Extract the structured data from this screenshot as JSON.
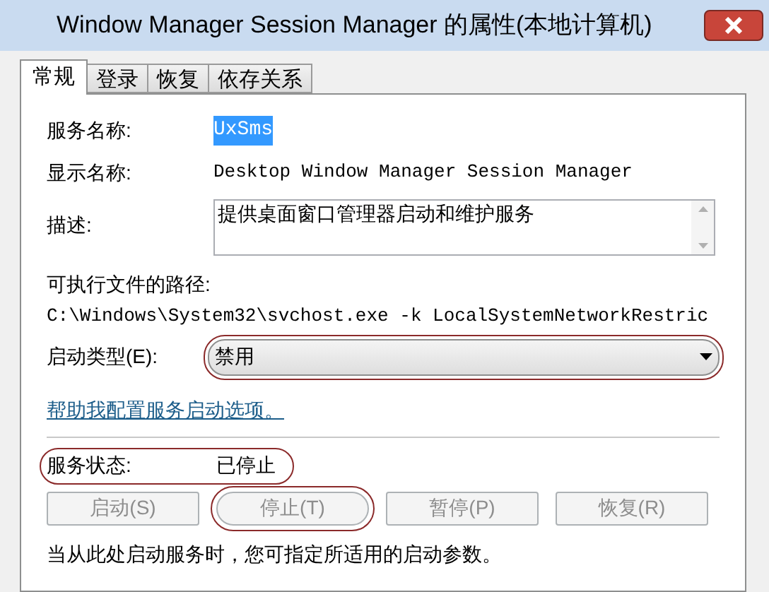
{
  "window": {
    "title": "Window Manager Session Manager 的属性(本地计算机)"
  },
  "tabs": [
    {
      "label": "常规",
      "selected": true
    },
    {
      "label": "登录",
      "selected": false
    },
    {
      "label": "恢复",
      "selected": false
    },
    {
      "label": "依存关系",
      "selected": false
    }
  ],
  "service_name": {
    "label": "服务名称:",
    "value": "UxSms",
    "selected": true
  },
  "display_name": {
    "label": "显示名称:",
    "value": "Desktop Window Manager Session Manager"
  },
  "description": {
    "label": "描述:",
    "value": "提供桌面窗口管理器启动和维护服务"
  },
  "executable_path": {
    "label": "可执行文件的路径:",
    "value": "C:\\Windows\\System32\\svchost.exe -k LocalSystemNetworkRestric"
  },
  "startup_type": {
    "label": "启动类型(E):",
    "value": "禁用",
    "circled": true
  },
  "help_link": "帮助我配置服务启动选项。",
  "service_status": {
    "label": "服务状态:",
    "value": "已停止",
    "circled": true
  },
  "buttons": [
    {
      "label": "启动(S)",
      "disabled": true,
      "circled": false
    },
    {
      "label": "停止(T)",
      "disabled": true,
      "circled": true
    },
    {
      "label": "暂停(P)",
      "disabled": true,
      "circled": false
    },
    {
      "label": "恢复(R)",
      "disabled": true,
      "circled": false
    }
  ],
  "note": "当从此处启动服务时，您可指定所适用的启动参数。"
}
